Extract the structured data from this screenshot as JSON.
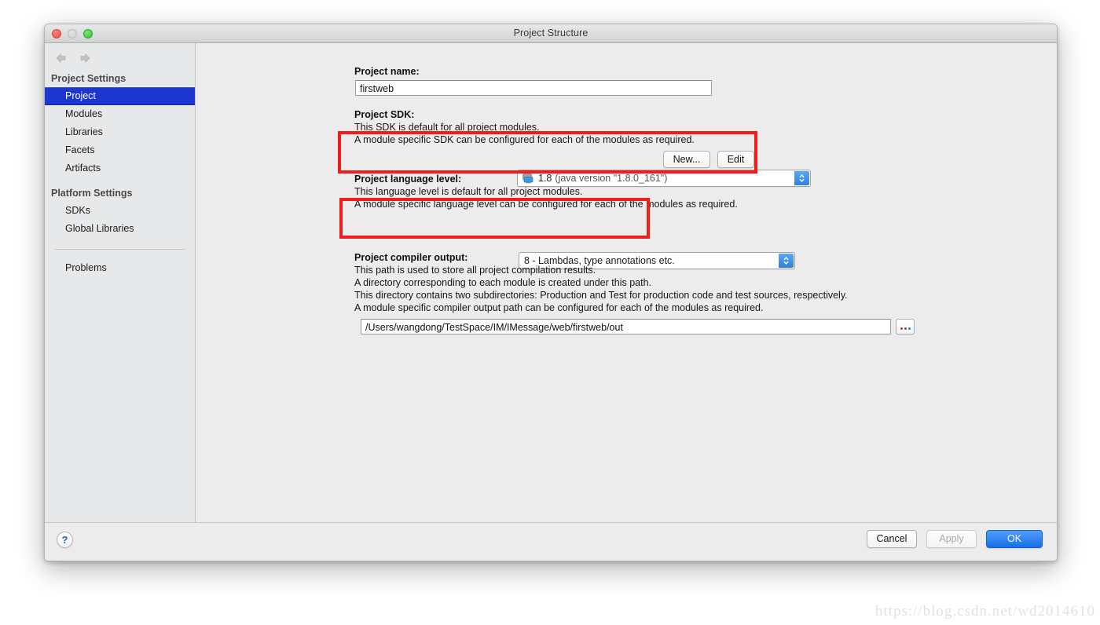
{
  "window": {
    "title": "Project Structure",
    "traffic_lights": [
      "close-red",
      "minimize-grey",
      "zoom-green"
    ]
  },
  "sidebar": {
    "nav": {
      "back": "back-arrow",
      "forward": "forward-arrow"
    },
    "sections": [
      {
        "title": "Project Settings",
        "items": [
          {
            "label": "Project",
            "selected": true
          },
          {
            "label": "Modules",
            "selected": false
          },
          {
            "label": "Libraries",
            "selected": false
          },
          {
            "label": "Facets",
            "selected": false
          },
          {
            "label": "Artifacts",
            "selected": false
          }
        ]
      },
      {
        "title": "Platform Settings",
        "items": [
          {
            "label": "SDKs",
            "selected": false
          },
          {
            "label": "Global Libraries",
            "selected": false
          }
        ]
      }
    ],
    "problems_label": "Problems"
  },
  "main": {
    "project_name": {
      "label": "Project name:",
      "value": "firstweb"
    },
    "project_sdk": {
      "label": "Project SDK:",
      "desc_line1": "This SDK is default for all project modules.",
      "desc_line2": "A module specific SDK can be configured for each of the modules as required.",
      "selected_version": "1.8",
      "selected_detail": "(java version \"1.8.0_161\")",
      "new_button": "New...",
      "edit_button": "Edit"
    },
    "language_level": {
      "label": "Project language level:",
      "desc_line1": "This language level is default for all project modules.",
      "desc_line2": "A module specific language level can be configured for each of the modules as required.",
      "selected": "8 - Lambdas, type annotations etc."
    },
    "compiler_output": {
      "label": "Project compiler output:",
      "desc_line1": "This path is used to store all project compilation results.",
      "desc_line2": "A directory corresponding to each module is created under this path.",
      "desc_line3": "This directory contains two subdirectories: Production and Test for production code and test sources, respectively.",
      "desc_line4": "A module specific compiler output path can be configured for each of the modules as required.",
      "path_value": "/Users/wangdong/TestSpace/IM/IMessage/web/firstweb/out",
      "browse_button": "..."
    }
  },
  "footer": {
    "help_label": "?",
    "cancel_label": "Cancel",
    "apply_label": "Apply",
    "ok_label": "OK"
  },
  "annotations": {
    "highlight_color": "#f41b1b",
    "boxes": [
      "sdk-selector-highlight",
      "language-level-highlight"
    ]
  },
  "watermark": {
    "text": "https://blog.csdn.net/wd2014610"
  }
}
